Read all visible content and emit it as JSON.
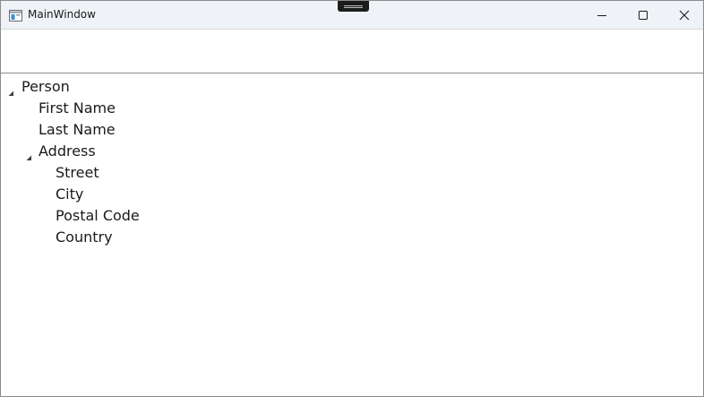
{
  "window": {
    "title": "MainWindow",
    "icon": "window-app-icon"
  },
  "caption_buttons": {
    "minimize_icon": "minimize-icon",
    "maximize_icon": "maximize-icon",
    "close_icon": "close-icon"
  },
  "tree": {
    "root": {
      "label": "Person",
      "expanded": true,
      "children": {
        "first_name": "First Name",
        "last_name": "Last Name",
        "address": {
          "label": "Address",
          "expanded": true,
          "children": {
            "street": "Street",
            "city": "City",
            "postal_code": "Postal Code",
            "country": "Country"
          }
        }
      }
    }
  },
  "colors": {
    "titlebar": "#eff2f7",
    "text": "#1a1a1a",
    "separator": "#8a8a8a"
  }
}
